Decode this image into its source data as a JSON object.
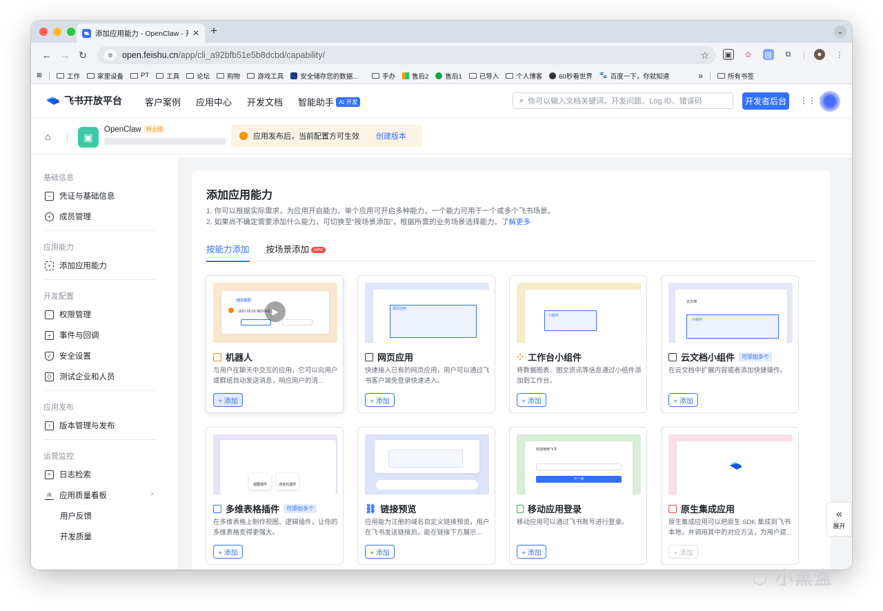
{
  "browser": {
    "tab_title": "添加应用能力 - OpenClaw - 开",
    "url_domain": "open.feishu.cn",
    "url_path": "/app/cli_a92bfb51e5b8dcbd/capability/",
    "bookmarks": [
      "工作",
      "家里设备",
      "PT",
      "工具",
      "论坛",
      "购物",
      "游戏工具",
      "安全储存您的数据...",
      "手办",
      "售后2",
      "售后1",
      "已导入",
      "个人博客",
      "60秒看世界",
      "百度一下，你就知道"
    ],
    "bookmarks_overflow": "»",
    "all_bookmarks": "所有书签"
  },
  "header": {
    "logo_text": "飞书开放平台",
    "nav": [
      "客户案例",
      "应用中心",
      "开发文档",
      "智能助手"
    ],
    "ai_badge": "AI 开发",
    "search_placeholder": "你可以输入文档关键词、开发问题、Log ID、错误码",
    "dev_button": "开发者后台"
  },
  "app": {
    "name": "OpenClaw",
    "status": "待上线",
    "notice": "应用发布后，当前配置方可生效",
    "notice_link": "创建版本"
  },
  "sidebar": {
    "groups": [
      {
        "title": "基础信息",
        "items": [
          "凭证与基础信息",
          "成员管理"
        ]
      },
      {
        "title": "应用能力",
        "items": [
          "添加应用能力"
        ]
      },
      {
        "title": "开发配置",
        "items": [
          "权限管理",
          "事件与回调",
          "安全设置",
          "测试企业和人员"
        ]
      },
      {
        "title": "应用发布",
        "items": [
          "版本管理与发布"
        ]
      },
      {
        "title": "运营监控",
        "items": [
          "日志检索",
          "应用质量看板"
        ]
      }
    ],
    "sub_items": [
      "用户反馈",
      "开发质量"
    ]
  },
  "main": {
    "title": "添加应用能力",
    "desc1": "1. 你可以根据实际需求，为应用开启能力。单个应用可开启多种能力，一个能力可用于一个或多个飞书场景。",
    "desc2": "2. 如果尚不确定需要添加什么能力，可切换至“按场景添加”，根据所需的业务场景选择能力。",
    "desc_link": "了解更多",
    "tabs": [
      "按能力添加",
      "按场景添加"
    ],
    "new_badge": "new",
    "add_label": "+ 添加",
    "multi_badge": "可添加多个",
    "cards": [
      {
        "title": "机器人",
        "desc": "与用户在聊天中交互的应用，它可以向用户或群组自动发送消息，响应用户的消..."
      },
      {
        "title": "网页应用",
        "desc": "快速接入已有的网页应用，用户可以通过飞书客户端免登录快速进入。"
      },
      {
        "title": "工作台小组件",
        "desc": "将数据图表、图文资讯等信息通过小组件添加到工作台。"
      },
      {
        "title": "云文档小组件",
        "desc": "在云文档中扩展内容或者添加快捷操作。"
      },
      {
        "title": "多维表格插件",
        "desc": "在多维表格上制作视图、逻辑插件，让你的多维表格变得更强大。"
      },
      {
        "title": "链接预览",
        "desc": "应用能为注册的域名自定义链接预览，用户在飞书发送链接后，能在链接下方展示..."
      },
      {
        "title": "移动应用登录",
        "desc": "移动应用可以通过飞书账号进行登录。"
      },
      {
        "title": "原生集成应用",
        "desc": "原生集成应用可以把原生 SDK 集成到飞书本地，并调用其中的对应方法，为用户提..."
      }
    ],
    "preview_text": {
      "bot_label": "待办事项",
      "bot_date": "2022-05-20 待办事项",
      "webapp": "网页应用",
      "widget": "小组件",
      "doc": "云文档",
      "login_welcome": "欢迎使用飞书",
      "login_next": "下一步",
      "table_view": "视图插件",
      "table_auto": "自动化插件"
    }
  },
  "expand_label": "展开",
  "watermark": "小黑盒",
  "colors": {
    "brand": "#3370ff",
    "warning": "#ff8800",
    "new_badge": "#f54a45"
  }
}
